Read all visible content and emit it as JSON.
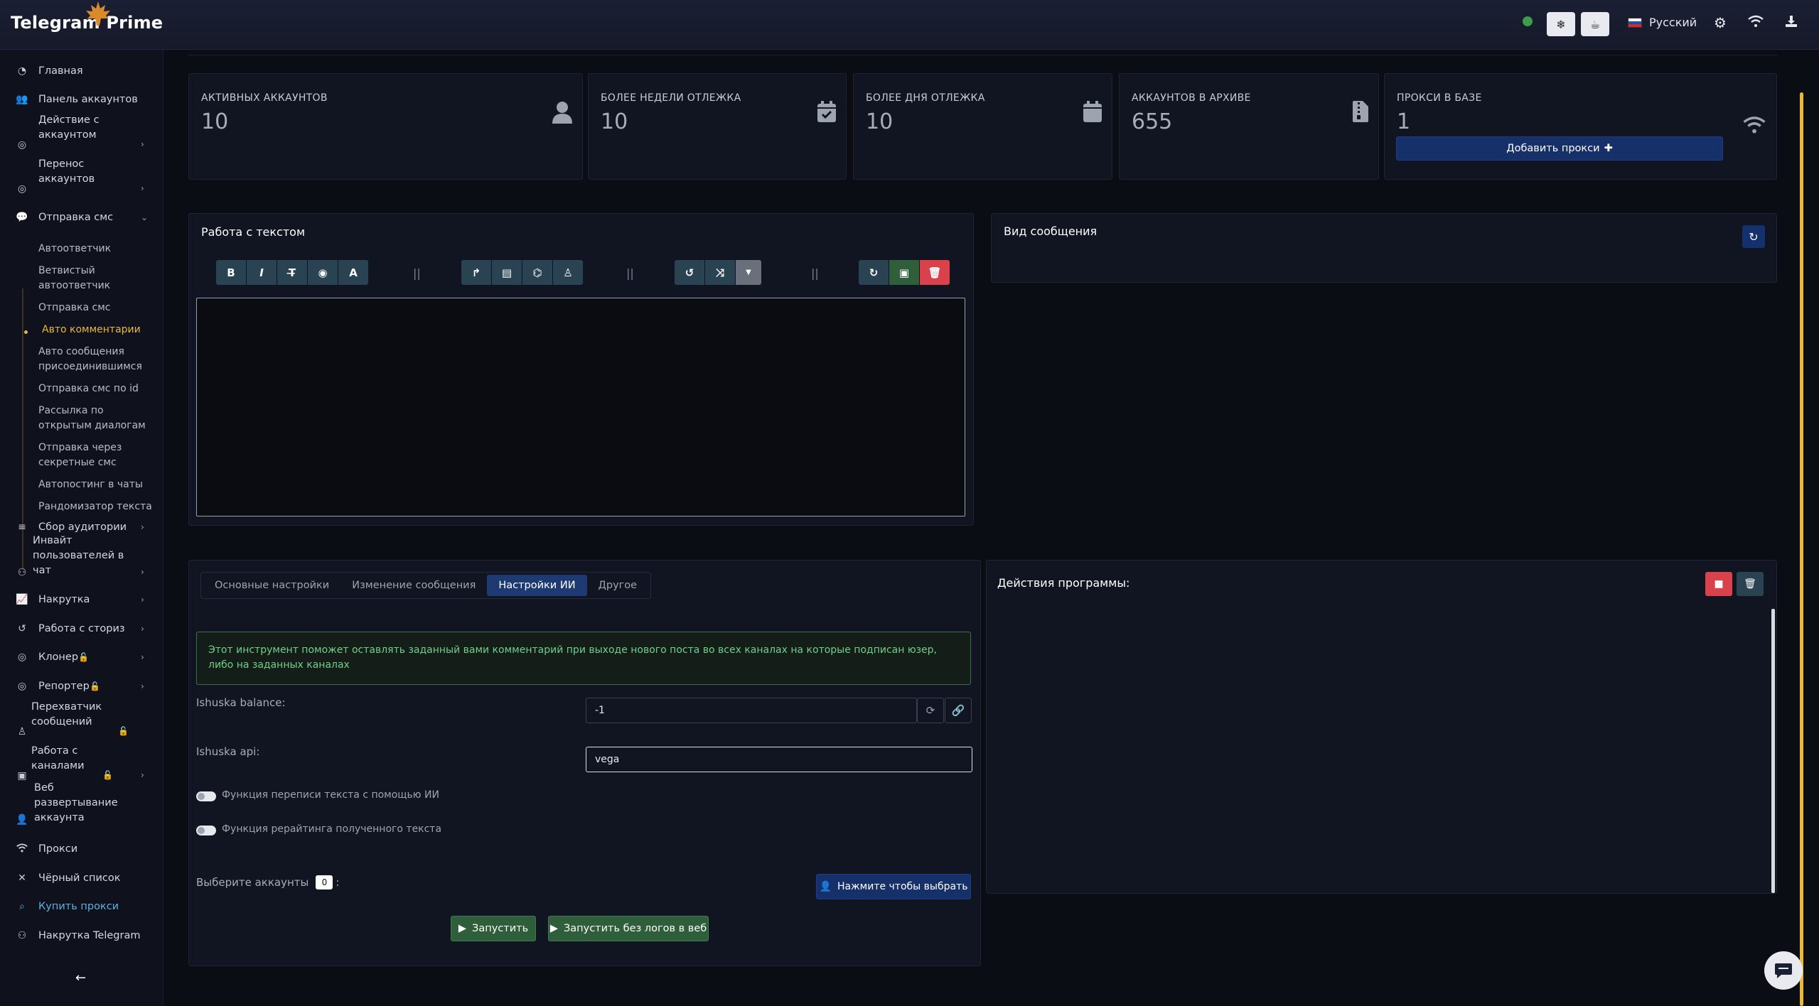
{
  "brand": "Telegram Prime",
  "topbar": {
    "language": "Русский",
    "icons": [
      "snowflake-icon",
      "coffee-icon",
      "gear-icon",
      "wifi-icon",
      "download-icon"
    ]
  },
  "sidebar": {
    "items": [
      {
        "label": "Главная",
        "icon": "dashboard-icon"
      },
      {
        "label": "Панель аккаунтов",
        "icon": "users-icon"
      },
      {
        "label": "Действие с аккаунтом",
        "icon": "user-circle-icon"
      },
      {
        "label": "Перенос аккаунтов",
        "icon": "transfer-icon"
      },
      {
        "label": "Отправка смс",
        "icon": "comments-icon"
      },
      {
        "label": "Сбор аудитории",
        "icon": "database-icon"
      },
      {
        "label": "Инвайт пользователей в чат",
        "icon": "handshake-icon"
      },
      {
        "label": "Накрутка",
        "icon": "chart-line-icon"
      },
      {
        "label": "Работа с сториз",
        "icon": "history-icon"
      },
      {
        "label": "Клонер",
        "icon": "clone-icon"
      },
      {
        "label": "Репортер",
        "icon": "report-icon"
      },
      {
        "label": "Перехватчик сообщений",
        "icon": "spy-icon"
      },
      {
        "label": "Работа с каналами",
        "icon": "channel-icon"
      },
      {
        "label": "Веб развертывание аккаунта",
        "icon": "user-tie-icon"
      },
      {
        "label": "Прокси",
        "icon": "wifi-icon"
      },
      {
        "label": "Чёрный список",
        "icon": "close-icon"
      },
      {
        "label": "Купить прокси",
        "icon": "search-dollar-icon"
      },
      {
        "label": "Накрутка Telegram",
        "icon": "handshake-icon"
      }
    ],
    "sub_items": [
      "Автоответчик",
      "Ветвистый автоответчик",
      "Отправка смс",
      "Авто комментарии",
      "Авто сообщения присоединившимся",
      "Отправка смс по id",
      "Рассылка по открытым диалогам",
      "Отправка через секретные смс",
      "Автопостинг в чаты",
      "Рандомизатор текста"
    ]
  },
  "stats": [
    {
      "label": "АКТИВНЫХ АККАУНТОВ",
      "value": "10",
      "icon": "user-icon"
    },
    {
      "label": "БОЛЕЕ НЕДЕЛИ ОТЛЕЖКА",
      "value": "10",
      "icon": "calendar-check-icon"
    },
    {
      "label": "БОЛЕЕ ДНЯ ОТЛЕЖКА",
      "value": "10",
      "icon": "calendar-icon"
    },
    {
      "label": "АККАУНТОВ В АРХИВЕ",
      "value": "655",
      "icon": "archive-icon"
    },
    {
      "label": "ПРОКСИ В БАЗЕ",
      "value": "1",
      "icon": "wifi-icon"
    }
  ],
  "add_proxy_label": "Добавить прокси",
  "text_panel": {
    "title": "Работа с текстом",
    "text_value": "",
    "separator": "||"
  },
  "preview_panel": {
    "title": "Вид сообщения"
  },
  "settings": {
    "tabs": [
      "Основные настройки",
      "Изменение сообщения",
      "Настройки ИИ",
      "Другое"
    ],
    "active_tab": "Настройки ИИ",
    "alert": "Этот инструмент поможет оставлять заданный вами комментарий при выходе нового поста во всех каналах на которые подписан юзер, либо на заданных каналах",
    "balance_label": "Ishuska balance:",
    "balance_value": "-1",
    "api_label": "Ishuska api:",
    "api_value": "vega",
    "toggle_rewrite": "Функция переписи текста с помощью ИИ",
    "toggle_rewriting": "Функция рерайтинга полученного текста",
    "select_accounts_label": "Выберите аккаунты",
    "select_accounts_count": "0",
    "select_accounts_suffix": ":",
    "select_button": "Нажмите чтобы выбрать",
    "run_button": "Запустить",
    "run_nolog_button": "Запустить без логов в веб"
  },
  "actions_panel": {
    "title": "Действия программы:"
  },
  "colors": {
    "accent_blue": "#16306a",
    "success_green": "#2f5f3a",
    "danger_red": "#d9414b",
    "active_gold": "#e8b83c"
  }
}
